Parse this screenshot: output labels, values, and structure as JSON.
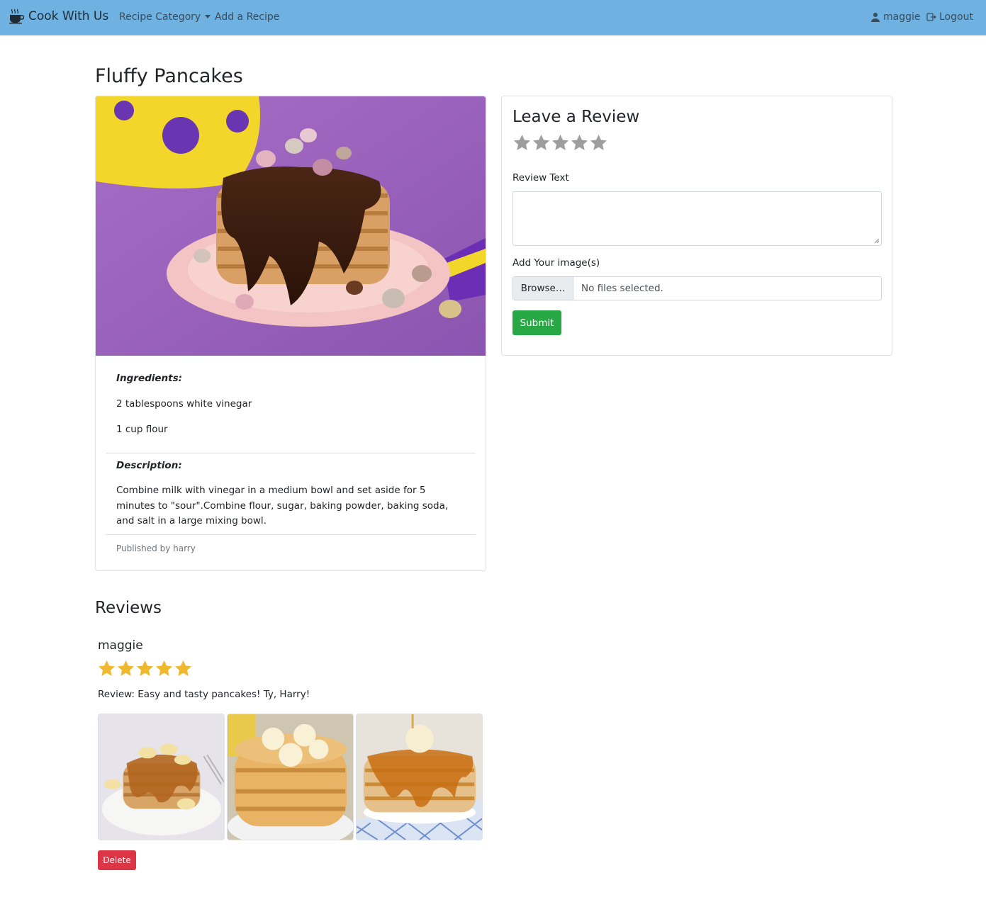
{
  "navbar": {
    "brand": "Cook With Us",
    "icon": "coffee-cup-icon",
    "category_label": "Recipe Category",
    "add_label": "Add a Recipe",
    "user_label": "maggie",
    "logout_label": "Logout",
    "bg_color": "#6fb1e0"
  },
  "recipe": {
    "title": "Fluffy Pancakes",
    "image": "chocolate-pancake-stack-photo",
    "ingredients_label": "Ingredients:",
    "ingredients": [
      "2 tablespoons white vinegar",
      "1 cup flour"
    ],
    "description_label": "Description:",
    "description": "Combine milk with vinegar in a medium bowl and set aside for 5 minutes to \"sour\".Combine flour, sugar, baking powder, baking soda, and salt in a large mixing bowl.",
    "published": "Published by harry"
  },
  "review_form": {
    "heading": "Leave a Review",
    "rating": 0,
    "max_rating": 5,
    "review_text_label": "Review Text",
    "review_text_value": "",
    "images_label": "Add Your image(s)",
    "browse_label": "Browse…",
    "file_status": "No files selected.",
    "submit_label": "Submit",
    "submit_color": "#28a745"
  },
  "reviews": {
    "heading": "Reviews",
    "items": [
      {
        "author": "maggie",
        "rating": 5,
        "text": "Review: Easy and tasty pancakes! Ty, Harry!",
        "images": [
          "banana-caramel-pancakes-photo",
          "banana-pancake-stack-photo",
          "syrup-pancake-stack-photo"
        ],
        "delete_label": "Delete"
      }
    ],
    "star_color": "#f0b82c",
    "delete_color": "#dc3545"
  }
}
